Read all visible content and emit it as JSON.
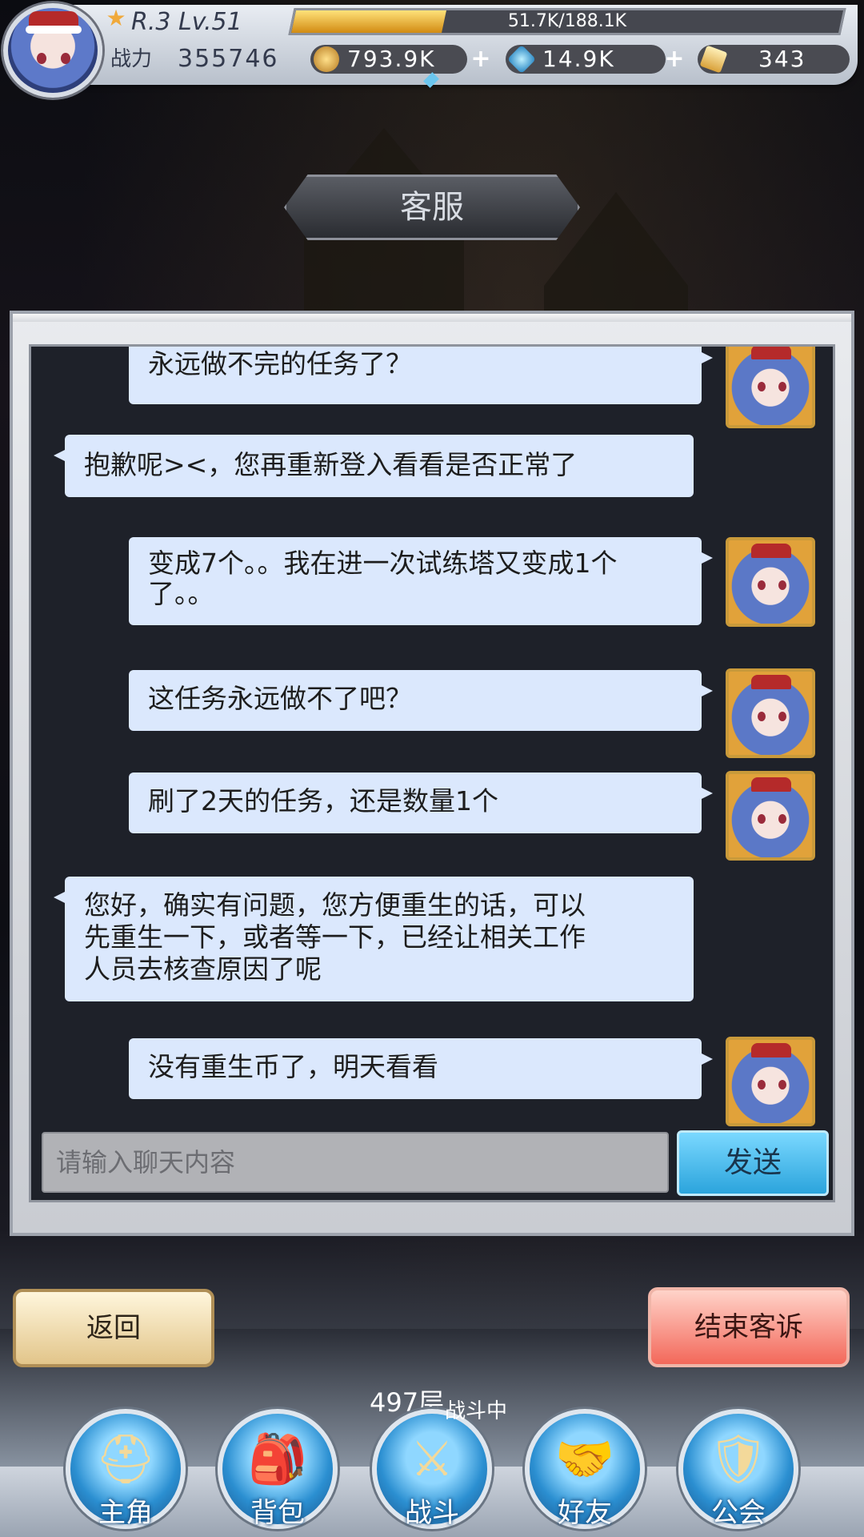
{
  "hud": {
    "level_text": "R.3 Lv.51",
    "exp_text": "51.7K/188.1K",
    "exp_fraction": 0.275,
    "power_label": "战力",
    "power_value": "355746",
    "gold": "793.9K",
    "gems": "14.9K",
    "tickets": "343",
    "plus_symbol": "+",
    "icons": {
      "rank": "star-rank-icon",
      "gold": "gold-coin-icon",
      "gems": "blue-gem-icon",
      "tickets": "ticket-icon"
    }
  },
  "title": "客服",
  "chat": {
    "messages": [
      {
        "sender": "user",
        "lines": [
          "永远做不完的任务了？"
        ]
      },
      {
        "sender": "agent",
        "lines": [
          "抱歉呢><，您再重新登入看看是否正常了"
        ]
      },
      {
        "sender": "user",
        "lines": [
          "变成7个。。我在进一次试练塔又变成1个",
          "了。。"
        ]
      },
      {
        "sender": "user",
        "lines": [
          "这任务永远做不了吧？"
        ]
      },
      {
        "sender": "user",
        "lines": [
          "刷了2天的任务，还是数量1个"
        ]
      },
      {
        "sender": "agent",
        "lines": [
          "您好，确实有问题，您方便重生的话，可以",
          "先重生一下，或者等一下，已经让相关工作",
          "人员去核查原因了呢"
        ]
      },
      {
        "sender": "user",
        "lines": [
          "没有重生币了，明天看看"
        ]
      }
    ],
    "input_placeholder": "请输入聊天内容",
    "send_label": "发送"
  },
  "buttons": {
    "back_label": "返回",
    "end_complaint_label": "结束客诉"
  },
  "status": {
    "floor": "497层",
    "battle": "战斗中"
  },
  "nav": {
    "items": [
      {
        "label": "主角",
        "icon": "helmet-icon"
      },
      {
        "label": "背包",
        "icon": "backpack-icon"
      },
      {
        "label": "战斗",
        "icon": "crossed-swords-icon"
      },
      {
        "label": "好友",
        "icon": "handshake-icon"
      },
      {
        "label": "公会",
        "icon": "guild-crest-icon"
      }
    ]
  },
  "colors": {
    "bubble": "#dbe8fd",
    "send_button": "#2ba4dc",
    "end_button": "#f3685a",
    "back_button": "#e2c58a",
    "exp_fill": "#f2b23a"
  }
}
